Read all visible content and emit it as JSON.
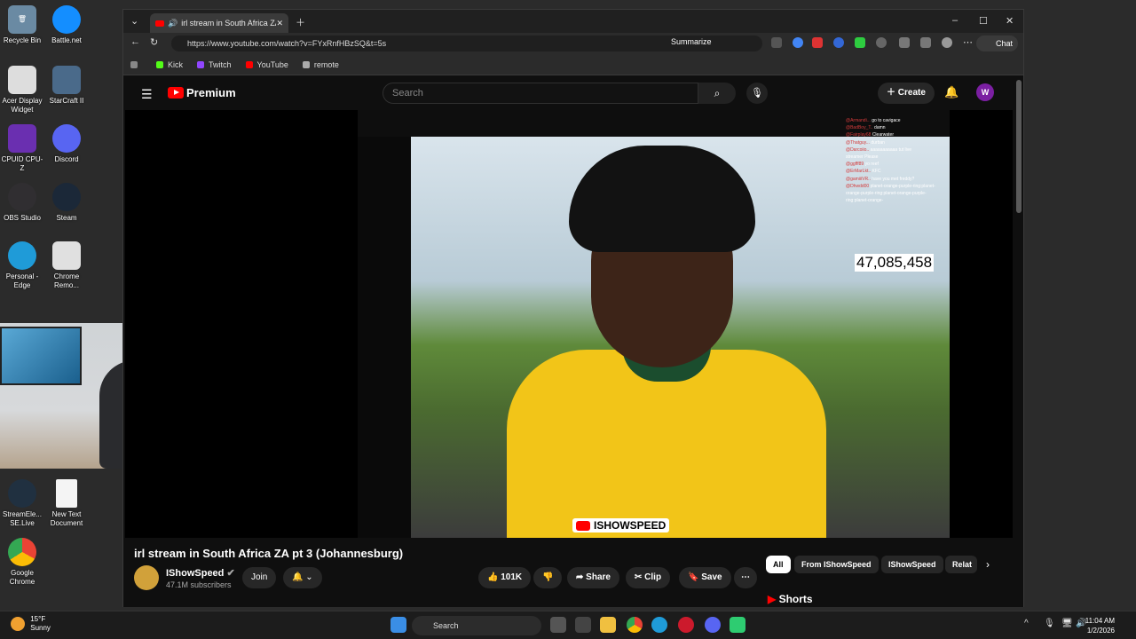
{
  "desktop": {
    "icons": [
      {
        "label": "Recycle Bin"
      },
      {
        "label": "Battle.net"
      },
      {
        "label": "Acer Display Widget"
      },
      {
        "label": "StarCraft II"
      },
      {
        "label": "CPUID CPU-Z"
      },
      {
        "label": "Discord"
      },
      {
        "label": "OBS Studio"
      },
      {
        "label": "Steam"
      },
      {
        "label": "Personal - Edge"
      },
      {
        "label": "Chrome Remo..."
      },
      {
        "label": "StreamEle... SE.Live"
      },
      {
        "label": "New Text Document"
      },
      {
        "label": "Google Chrome"
      }
    ]
  },
  "browser": {
    "tab_title": "irl stream in South Africa ZA pt",
    "url": "https://www.youtube.com/watch?v=FYxRnfHBzSQ&t=5s",
    "summarize_label": "Summarize",
    "chat_label": "Chat",
    "bookmarks": [
      "Kick",
      "Twitch",
      "YouTube",
      "remote"
    ]
  },
  "youtube": {
    "logo_text": "Premium",
    "search_placeholder": "Search",
    "create_label": "Create",
    "avatar_letter": "W",
    "video": {
      "counter": "47,085,458",
      "watermark": "ISHOWSPEED",
      "chat_lines": [
        {
          "user": "@Armandi...",
          "msg": "go to cavigace"
        },
        {
          "user": "@BadBoy_T..",
          "msg": "damn"
        },
        {
          "user": "@Fairplay68",
          "msg": "Clearwater"
        },
        {
          "user": "@Thatguy...",
          "msg": "durban"
        },
        {
          "user": "@Darcoiio..",
          "msg": "aaaaaaaaaaa tut live"
        },
        {
          "user": "",
          "msg": "streamer Please"
        },
        {
          "user": "@ggfff89",
          "msg": "yo reef"
        },
        {
          "user": "@ErMarLkt..",
          "msg": "KFC"
        },
        {
          "user": "@gamiiiVR..",
          "msg": "have you met freddy?"
        },
        {
          "user": "@Dhwdd00",
          "msg": "planet-orange-purple-ring:planet-orange-purple-ring:planet-orange-purple-ring:planet-orange-"
        }
      ]
    },
    "title": "irl stream in South Africa ZA pt 3 (Johannesburg)",
    "channel": {
      "name": "IShowSpeed",
      "subs": "47.1M subscribers"
    },
    "join_label": "Join",
    "likes": "101K",
    "share_label": "Share",
    "clip_label": "Clip",
    "save_label": "Save",
    "chips": [
      "All",
      "From IShowSpeed",
      "IShowSpeed",
      "Relat"
    ],
    "shorts_label": "Shorts"
  },
  "taskbar": {
    "weather_temp": "15°F",
    "weather_desc": "Sunny",
    "search_label": "Search",
    "time": "11:04 AM",
    "date": "1/2/2026"
  },
  "colors": {
    "youtube_red": "#ff0000",
    "accent_yellow": "#f2c518"
  }
}
